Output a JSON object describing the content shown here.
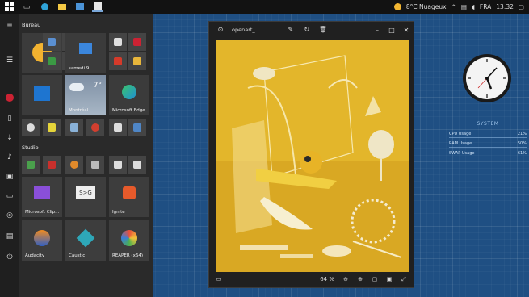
{
  "taskbar": {
    "items": [
      "start-icon",
      "task-view-icon",
      "edge-icon",
      "photos-icon",
      "file-explorer-icon",
      "settings-icon"
    ],
    "weather": "8°C Nuageux",
    "language": "FRA",
    "time": "13:32"
  },
  "start_menu": {
    "group_bureau": "Bureau",
    "group_studio": "Studio",
    "tiles": {
      "calendar_date": "samedi 9",
      "weather_city": "Montréal",
      "weather_temp": "7°",
      "edge": "Microsoft Edge",
      "clipchamp": "Microsoft Clip...",
      "ignite": "Ignite",
      "audacity": "Audacity",
      "caustic": "Caustic",
      "reaper": "REAPER (x64)"
    }
  },
  "viewer": {
    "filename": "openart_...",
    "zoom": "64 %"
  },
  "sysmon": {
    "title": "SYSTEM",
    "rows": [
      {
        "label": "CPU Usage",
        "value": "21%"
      },
      {
        "label": "RAM Usage",
        "value": "50%"
      },
      {
        "label": "SWAP Usage",
        "value": "61%"
      }
    ]
  },
  "colors": {
    "desktop": "#1f4f83",
    "photo_bg": "#e0b52a",
    "tile_bg": "#3b3b3b"
  }
}
